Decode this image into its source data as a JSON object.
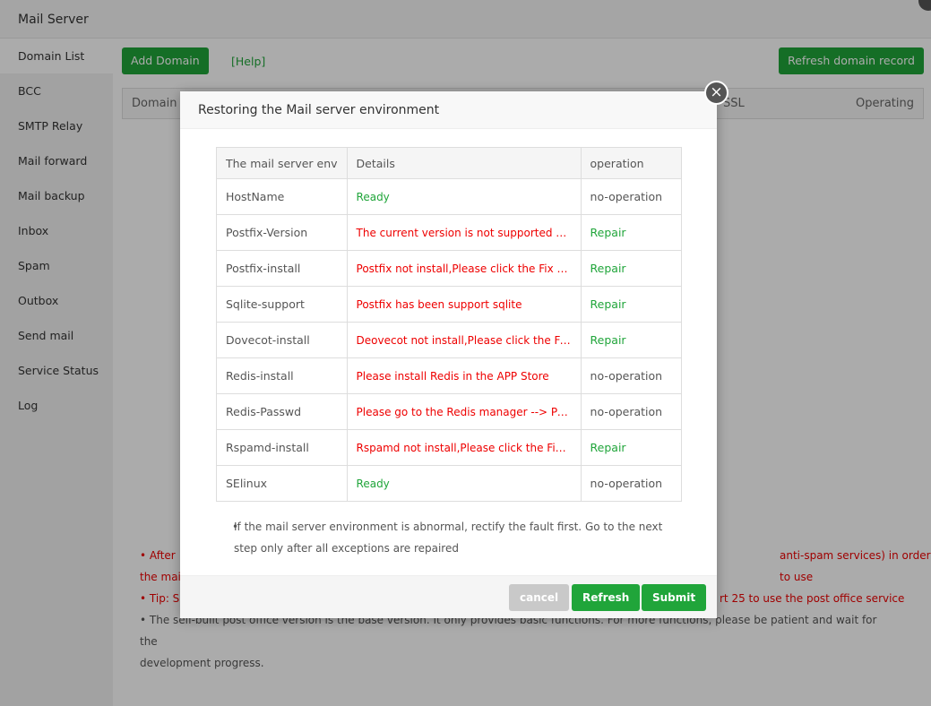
{
  "app_title": "Mail Server",
  "sidebar": [
    "Domain List",
    "BCC",
    "SMTP Relay",
    "Mail forward",
    "Mail backup",
    "Inbox",
    "Spam",
    "Outbox",
    "Send mail",
    "Service Status",
    "Log"
  ],
  "toolbar": {
    "add_domain": "Add Domain",
    "help": "[Help]",
    "refresh_record": "Refresh domain record"
  },
  "table_header": {
    "domain": "Domain",
    "ssl": "SSL",
    "operating": "Operating"
  },
  "bg_notes": {
    "n1a": "After",
    "n1b": "anti-spam services) in order to use",
    "n1c": "the mail",
    "n2a": "Tip: S",
    "n2b": "rt 25 to use the post office service",
    "n3": "The self-built post office version is the base version. It only provides basic functions. For more functions, please be patient and wait for the",
    "n3b": "development progress."
  },
  "modal": {
    "title": "Restoring the Mail server environment",
    "columns": [
      "The mail server env",
      "Details",
      "operation"
    ],
    "rows": [
      {
        "env": "HostName",
        "details": "Ready",
        "ok": true,
        "op": "no-operation"
      },
      {
        "env": "Postfix-Version",
        "details": "The current version is not supported or ...",
        "ok": false,
        "op": "Repair"
      },
      {
        "env": "Postfix-install",
        "details": "Postfix not install,Please click the Fix bu...",
        "ok": false,
        "op": "Repair"
      },
      {
        "env": "Sqlite-support",
        "details": "Postfix has been support sqlite",
        "ok": false,
        "op": "Repair"
      },
      {
        "env": "Dovecot-install",
        "details": "Deovecot not install,Please click the Fix ...",
        "ok": false,
        "op": "Repair"
      },
      {
        "env": "Redis-install",
        "details": "Please install Redis in the APP Store",
        "ok": false,
        "op": "no-operation"
      },
      {
        "env": "Redis-Passwd",
        "details": "Please go to the Redis manager --> Per...",
        "ok": false,
        "op": "no-operation"
      },
      {
        "env": "Rspamd-install",
        "details": "Rspamd not install,Please click the Fix b...",
        "ok": false,
        "op": "Repair"
      },
      {
        "env": "SElinux",
        "details": "Ready",
        "ok": true,
        "op": "no-operation"
      }
    ],
    "note": "If the mail server environment is abnormal, rectify the fault first. Go to the next step only after all exceptions are repaired",
    "cancel": "cancel",
    "refresh": "Refresh",
    "submit": "Submit",
    "close": "×"
  }
}
